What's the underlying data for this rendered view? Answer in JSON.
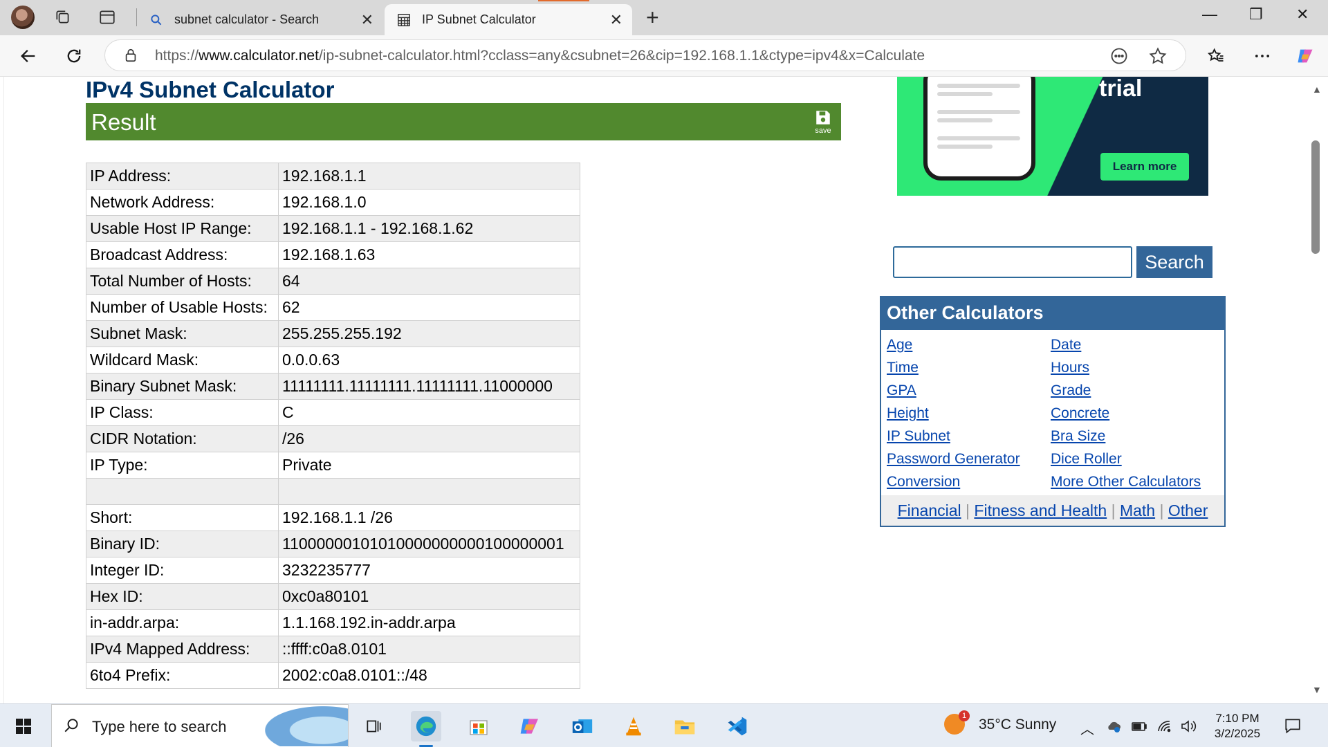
{
  "browser": {
    "tabs": [
      {
        "title": "subnet calculator - Search",
        "active": false
      },
      {
        "title": "IP Subnet Calculator",
        "active": true
      }
    ],
    "url_prefix": "https://",
    "url_host": "www.calculator.net",
    "url_path": "/ip-subnet-calculator.html?cclass=any&csubnet=26&cip=192.168.1.1&ctype=ipv4&x=Calculate"
  },
  "page": {
    "title": "IPv4 Subnet Calculator",
    "result_heading": "Result",
    "save_label": "save",
    "rows": [
      {
        "key": "IP Address:",
        "value": "192.168.1.1"
      },
      {
        "key": "Network Address:",
        "value": "192.168.1.0"
      },
      {
        "key": "Usable Host IP Range:",
        "value": "192.168.1.1 - 192.168.1.62"
      },
      {
        "key": "Broadcast Address:",
        "value": "192.168.1.63"
      },
      {
        "key": "Total Number of Hosts:",
        "value": "64"
      },
      {
        "key": "Number of Usable Hosts:",
        "value": "62"
      },
      {
        "key": "Subnet Mask:",
        "value": "255.255.255.192"
      },
      {
        "key": "Wildcard Mask:",
        "value": "0.0.0.63"
      },
      {
        "key": "Binary Subnet Mask:",
        "value": "11111111.11111111.11111111.11000000"
      },
      {
        "key": "IP Class:",
        "value": "C"
      },
      {
        "key": "CIDR Notation:",
        "value": "/26"
      },
      {
        "key": "IP Type:",
        "value": "Private"
      },
      {
        "key": "",
        "value": ""
      },
      {
        "key": "Short:",
        "value": "192.168.1.1 /26"
      },
      {
        "key": "Binary ID:",
        "value": "11000000101010000000000100000001"
      },
      {
        "key": "Integer ID:",
        "value": "3232235777"
      },
      {
        "key": "Hex ID:",
        "value": "0xc0a80101"
      },
      {
        "key": "in-addr.arpa:",
        "value": "1.1.168.192.in-addr.arpa"
      },
      {
        "key": "IPv4 Mapped Address:",
        "value": "::ffff:c0a8.0101"
      },
      {
        "key": "6to4 Prefix:",
        "value": "2002:c0a8.0101::/48"
      }
    ]
  },
  "ad": {
    "headline": "trial",
    "cta": "Learn more"
  },
  "sidebar": {
    "search_button": "Search",
    "other_title": "Other Calculators",
    "links_left": [
      "Age",
      "Time",
      "GPA",
      "Height",
      "IP Subnet",
      "Password Generator",
      "Conversion"
    ],
    "links_right": [
      "Date",
      "Hours",
      "Grade",
      "Concrete",
      "Bra Size",
      "Dice Roller",
      "More Other Calculators"
    ],
    "footer_links": [
      "Financial",
      "Fitness and Health",
      "Math",
      "Other"
    ]
  },
  "taskbar": {
    "search_placeholder": "Type here to search",
    "weather": "35°C  Sunny",
    "weather_badge": "1",
    "time": "7:10 PM",
    "date": "3/2/2025"
  },
  "colors": {
    "result_green": "#51892e",
    "title_blue": "#003366",
    "panel_blue": "#336699",
    "link_blue": "#0645ad"
  }
}
